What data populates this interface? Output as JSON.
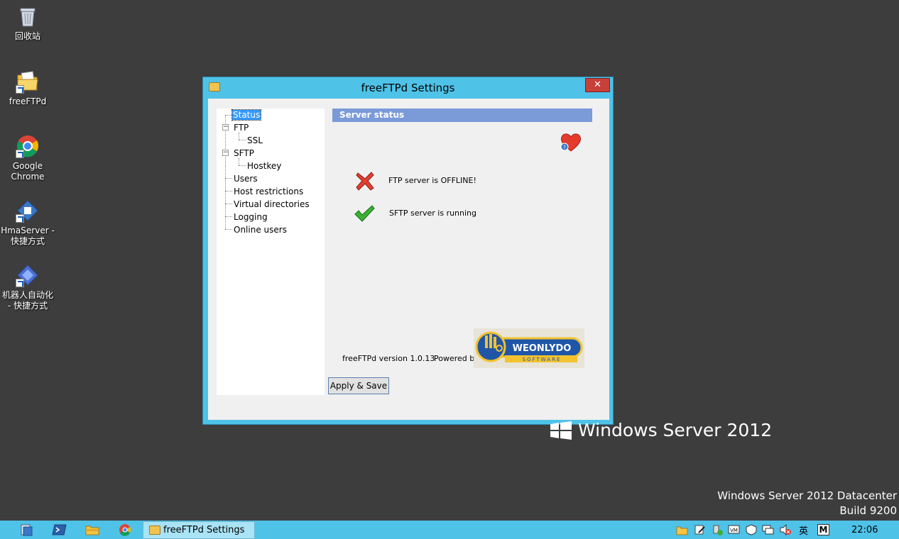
{
  "desktop": {
    "icons": [
      {
        "label": "回收站"
      },
      {
        "label": "freeFTPd"
      },
      {
        "label": "Google Chrome"
      },
      {
        "label": "HmaServer - 快捷方式"
      },
      {
        "label": "机器人自动化 - 快捷方式"
      }
    ],
    "branding": "Windows Server 2012",
    "edition_line1": "Windows Server 2012 Datacenter",
    "edition_line2": "Build 9200"
  },
  "window": {
    "title": "freeFTPd Settings",
    "close_label": "✕",
    "tree": {
      "items": [
        "Status",
        "FTP",
        "SSL",
        "SFTP",
        "Hostkey",
        "Users",
        "Host restrictions",
        "Virtual directories",
        "Logging",
        "Online users"
      ],
      "selected": "Status"
    },
    "panel_header": "Server status",
    "status_lines": [
      {
        "text": "FTP server is OFFLINE!",
        "state": "error"
      },
      {
        "text": "SFTP server is running",
        "state": "ok"
      }
    ],
    "version": "freeFTPd version 1.0.13",
    "powered_by": "Powered by",
    "logo_text": "WEONLYDO",
    "logo_subtext": "SOFTWARE",
    "apply_button": "Apply & Save"
  },
  "taskbar": {
    "active_task": "freeFTPd Settings",
    "ime_label": "英",
    "m_label": "M",
    "clock": "22:06"
  },
  "colors": {
    "desktop_bg": "#3d3d3d",
    "window_frame": "#4fc2e8",
    "header_bg": "#7a9ad8",
    "close_red": "#c7403a"
  }
}
